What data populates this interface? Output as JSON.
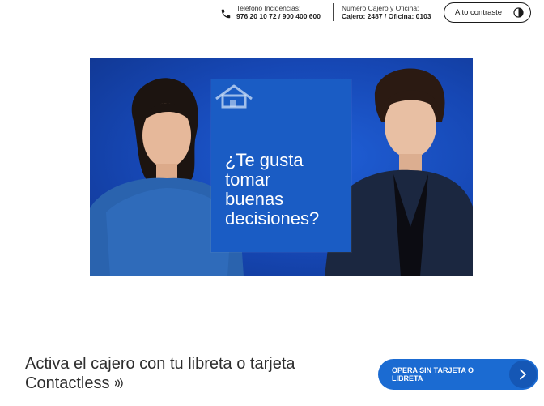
{
  "topbar": {
    "phone": {
      "label": "Teléfono Incidencias:",
      "value": "976 20 10 72 / 900 400 600",
      "icon": "phone-icon"
    },
    "atm": {
      "label": "Número Cajero y Oficina:",
      "value": "Cajero: 2487 / Oficina: 0103"
    },
    "contrast_button": {
      "label": "Alto contraste",
      "icon": "contrast-icon"
    }
  },
  "hero": {
    "headline_lines": [
      "¿Te gusta",
      "tomar",
      "buenas",
      "decisiones?"
    ],
    "icon": "house-icon",
    "colors": {
      "background": "#1647b4",
      "card": "#1a5cc4"
    }
  },
  "cta": {
    "title_line1": "Activa el cajero con tu libreta o tarjeta",
    "title_line2": "Contactless",
    "title_icon": "contactless-icon",
    "button_label": "OPERA SIN TARJETA O LIBRETA",
    "button_icon": "chevron-right-icon",
    "colors": {
      "button": "#1b6bd2"
    }
  }
}
